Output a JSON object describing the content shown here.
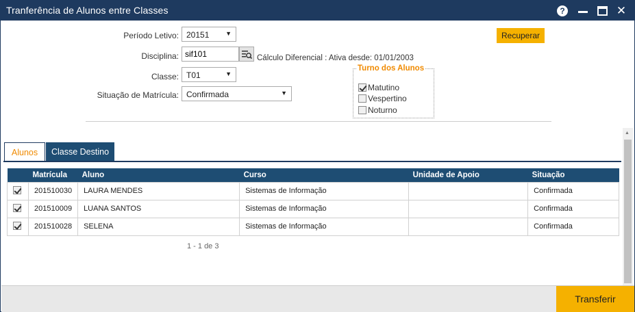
{
  "window": {
    "title": "Tranferência de Alunos entre Classes",
    "help_glyph": "?",
    "close_glyph": "✕"
  },
  "form": {
    "periodo_label": "Período Letivo:",
    "periodo_value": "20151",
    "disciplina_label": "Disciplina:",
    "disciplina_value": "sif101",
    "disciplina_info": "Cálculo Diferencial : Ativa desde: 01/01/2003",
    "classe_label": "Classe:",
    "classe_value": "T01",
    "situacao_label": "Situação de Matrícula:",
    "situacao_value": "Confirmada",
    "recuperar_label": "Recuperar"
  },
  "turno": {
    "legend": "Turno dos Alunos",
    "options": [
      {
        "label": "Matutino",
        "checked": true
      },
      {
        "label": "Vespertino",
        "checked": false
      },
      {
        "label": "Noturno",
        "checked": false
      }
    ]
  },
  "tabs": [
    {
      "label": "Alunos",
      "active": true
    },
    {
      "label": "Classe Destino",
      "active": false
    }
  ],
  "grid": {
    "columns": [
      "",
      "Matrícula",
      "Aluno",
      "Curso",
      "Unidade de Apoio",
      "Situação"
    ],
    "rows": [
      {
        "checked": true,
        "matricula": "201510030",
        "aluno": "LAURA MENDES",
        "curso": "Sistemas de Informação",
        "unidade": "",
        "situacao": "Confirmada"
      },
      {
        "checked": true,
        "matricula": "201510009",
        "aluno": "LUANA SANTOS",
        "curso": "Sistemas de Informação",
        "unidade": "",
        "situacao": "Confirmada"
      },
      {
        "checked": true,
        "matricula": "201510028",
        "aluno": "SELENA",
        "curso": "Sistemas de Informação",
        "unidade": "",
        "situacao": "Confirmada"
      }
    ],
    "pager": "1 - 1 de 3"
  },
  "footer": {
    "transferir_label": "Transferir"
  },
  "colors": {
    "titlebar": "#1e3a5f",
    "accent_orange": "#f5b100",
    "tab_active_text": "#f08a00",
    "grid_header": "#1e4d73"
  }
}
